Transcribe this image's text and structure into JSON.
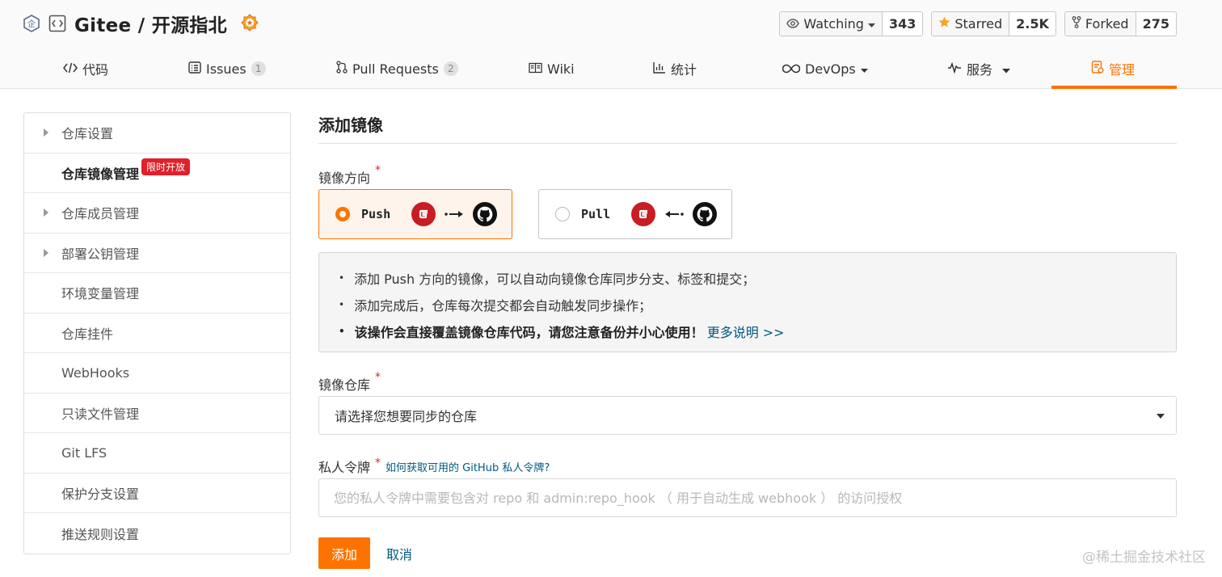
{
  "header": {
    "repo_name": "Gitee / 开源指北",
    "actions": [
      {
        "label": "Watching",
        "count": "343",
        "icon": "eye-icon",
        "has_dropdown": true
      },
      {
        "label": "Starred",
        "count": "2.5K",
        "icon": "star-icon"
      },
      {
        "label": "Forked",
        "count": "275",
        "icon": "fork-icon"
      }
    ]
  },
  "tabs": [
    {
      "label": "代码",
      "icon": "code-icon"
    },
    {
      "label": "Issues",
      "count": "1",
      "icon": "issues-icon"
    },
    {
      "label": "Pull Requests",
      "count": "2",
      "icon": "pull-request-icon"
    },
    {
      "label": "Wiki",
      "icon": "book-icon"
    },
    {
      "label": "统计",
      "icon": "bar-chart-icon"
    },
    {
      "label": "DevOps",
      "icon": "infinity-icon",
      "has_dropdown": true
    },
    {
      "label": "服务",
      "icon": "pulse-icon",
      "has_dropdown": true
    },
    {
      "label": "管理",
      "icon": "settings-doc-icon",
      "active": true
    }
  ],
  "sidebar": {
    "items": [
      {
        "label": "仓库设置",
        "expandable": true
      },
      {
        "label": "仓库镜像管理",
        "active": true,
        "badge": "限时开放"
      },
      {
        "label": "仓库成员管理",
        "expandable": true
      },
      {
        "label": "部署公钥管理",
        "expandable": true
      },
      {
        "label": "环境变量管理"
      },
      {
        "label": "仓库挂件"
      },
      {
        "label": "WebHooks"
      },
      {
        "label": "只读文件管理"
      },
      {
        "label": "Git LFS"
      },
      {
        "label": "保护分支设置"
      },
      {
        "label": "推送规则设置"
      }
    ]
  },
  "main": {
    "title": "添加镜像",
    "direction": {
      "label": "镜像方向",
      "options": [
        {
          "label": "Push",
          "selected": true,
          "arrow": "→"
        },
        {
          "label": "Pull",
          "selected": false,
          "arrow": "←"
        }
      ]
    },
    "info": {
      "lines": [
        "添加 Push 方向的镜像，可以自动向镜像仓库同步分支、标签和提交；",
        "添加完成后，仓库每次提交都会自动触发同步操作；",
        "该操作会直接覆盖镜像仓库代码，请您注意备份并小心使用！"
      ],
      "more_link": "更多说明 >>"
    },
    "repo": {
      "label": "镜像仓库",
      "select_text": "请选择您想要同步的仓库"
    },
    "token": {
      "label": "私人令牌",
      "help_link": "如何获取可用的 GitHub 私人令牌?",
      "placeholder": "您的私人令牌中需要包含对 repo 和 admin:repo_hook （ 用于自动生成 webhook ） 的访问授权",
      "value": ""
    },
    "buttons": {
      "add": "添加",
      "cancel": "取消"
    }
  },
  "watermark": "@稀土掘金技术社区",
  "colors": {
    "accent": "#fe7300",
    "link": "#005980",
    "danger": "#db2828",
    "gitee": "#c71d23"
  }
}
